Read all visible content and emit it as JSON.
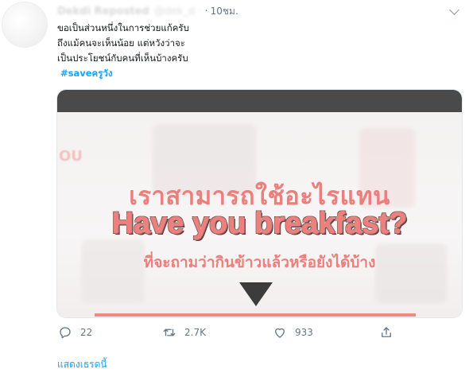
{
  "tweet": {
    "display_name": "Dekdi Reposted",
    "handle": "@dek_d ·",
    "dot": "·",
    "time": "10ชม.",
    "text_lines": [
      "ขอเป็นส่วนหนึ่งในการช่วยแก้ครับ",
      "ถึงแม้คนจะเห็นน้อย แต่หวังว่าจะ",
      "เป็นประโยชน์กับคนที่เห็นบ้างครับ"
    ],
    "hashtag": "#saveครูวัง"
  },
  "image": {
    "logo": "OU",
    "line1": "เราสามารถใช้อะไรแทน",
    "line2": "Have you breakfast?",
    "line3": "ที่จะถามว่ากินข้าวแล้วหรือยังได้บ้าง"
  },
  "actions": {
    "reply_count": "22",
    "retweet_count": "2.7K",
    "like_count": "933"
  },
  "footer": {
    "show_thread": "แสดงเธรดนี้"
  },
  "colors": {
    "accent": "#1da1f2",
    "pink": "#ec7e7b",
    "muted": "#657786"
  }
}
